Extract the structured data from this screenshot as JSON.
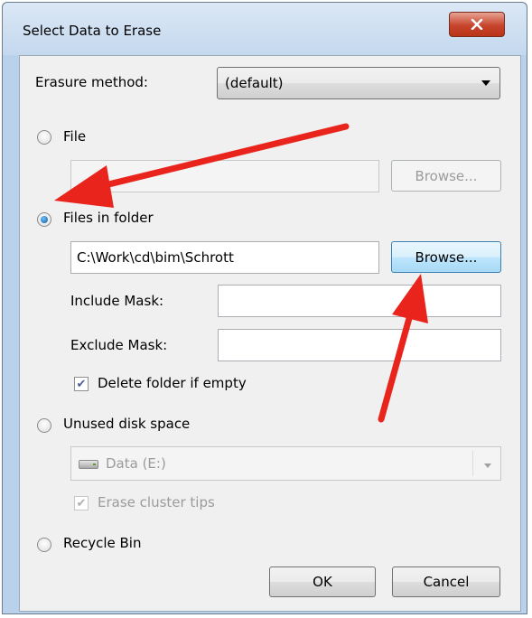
{
  "window": {
    "title": "Select Data to Erase"
  },
  "erasure": {
    "label": "Erasure method:",
    "value": "(default)"
  },
  "file_option": {
    "label": "File",
    "path": "",
    "browse": "Browse..."
  },
  "folder_option": {
    "label": "Files in folder",
    "path": "C:\\Work\\cd\\bim\\Schrott",
    "browse": "Browse...",
    "include_mask_label": "Include Mask:",
    "include_mask": "",
    "exclude_mask_label": "Exclude Mask:",
    "exclude_mask": "",
    "delete_if_empty_label": "Delete folder if empty",
    "delete_if_empty": true
  },
  "unused_space_option": {
    "label": "Unused disk space",
    "drive": "Data (E:)",
    "cluster_tips_label": "Erase cluster tips",
    "cluster_tips": true
  },
  "recycle_option": {
    "label": "Recycle Bin"
  },
  "footer": {
    "ok": "OK",
    "cancel": "Cancel"
  },
  "colors": {
    "annotation_arrow": "#e8241c",
    "accent": "#3c7fb1"
  }
}
